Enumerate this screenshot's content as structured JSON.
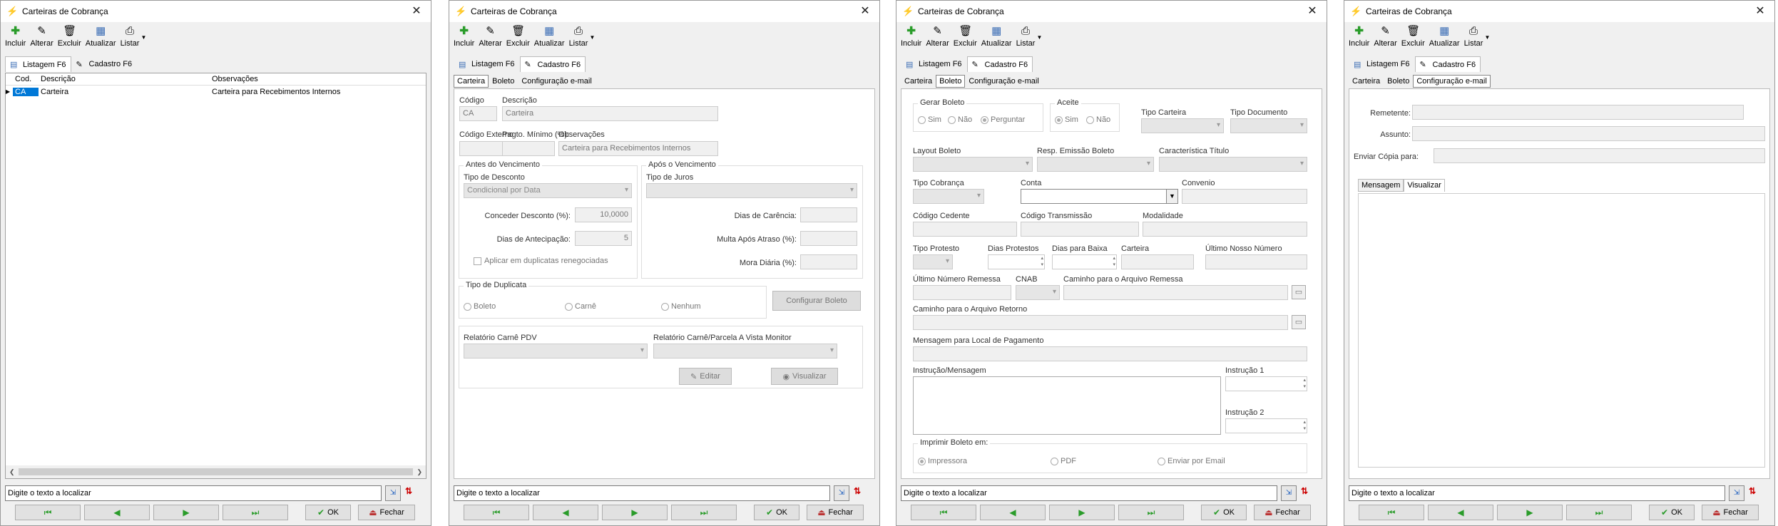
{
  "window_title": "Carteiras de Cobrança",
  "toolbar": {
    "incluir": "Incluir",
    "alterar": "Alterar",
    "excluir": "Excluir",
    "atualizar": "Atualizar",
    "listar": "Listar"
  },
  "tabs": {
    "listagem": "Listagem F6",
    "cadastro": "Cadastro F6"
  },
  "grid": {
    "columns": [
      "Cod.",
      "Descrição",
      "Observações"
    ],
    "rows": [
      {
        "cod": "CA",
        "descricao": "Carteira",
        "observacoes": "Carteira para Recebimentos Internos"
      }
    ]
  },
  "subtabs": {
    "carteira": "Carteira",
    "boleto": "Boleto",
    "email": "Configuração e-mail"
  },
  "carteira": {
    "codigo_label": "Código",
    "codigo": "CA",
    "descricao_label": "Descrição",
    "descricao": "Carteira",
    "codigo_externo_label": "Código Externo",
    "pagto_minimo_label": "Pagto. Mínimo (%):",
    "observacoes_label": "Observações",
    "observacoes": "Carteira para Recebimentos Internos",
    "antes_venc_title": "Antes do Vencimento",
    "tipo_desconto_label": "Tipo de Desconto",
    "tipo_desconto": "Condicional por Data",
    "conceder_desconto_label": "Conceder Desconto (%):",
    "conceder_desconto": "10,0000",
    "dias_antecipacao_label": "Dias de Antecipação:",
    "dias_antecipacao": "5",
    "aplicar_label": "Aplicar em duplicatas renegociadas",
    "apos_venc_title": "Após o Vencimento",
    "tipo_juros_label": "Tipo de Juros",
    "dias_carencia_label": "Dias de Carência:",
    "multa_label": "Multa Após Atraso (%):",
    "mora_label": "Mora Diária (%):",
    "tipo_duplicata_title": "Tipo de Duplicata",
    "dup_boleto": "Boleto",
    "dup_carne": "Carnê",
    "dup_nenhum": "Nenhum",
    "configurar_boleto": "Configurar Boleto",
    "relatorio_carne_label": "Relatório Carnê PDV",
    "relatorio_monitor_label": "Relatório Carnê/Parcela A Vista Monitor",
    "editar": "Editar",
    "visualizar": "Visualizar"
  },
  "boleto": {
    "gerar_title": "Gerar Boleto",
    "sim": "Sim",
    "nao": "Não",
    "perguntar": "Perguntar",
    "aceite_title": "Aceite",
    "tipo_carteira_label": "Tipo Carteira",
    "tipo_documento_label": "Tipo Documento",
    "layout_label": "Layout Boleto",
    "resp_emissao_label": "Resp. Emissão Boleto",
    "caracteristica_label": "Característica Título",
    "tipo_cobranca_label": "Tipo Cobrança",
    "conta_label": "Conta",
    "convenio_label": "Convenio",
    "codigo_cedente_label": "Código Cedente",
    "codigo_transmissao_label": "Código Transmissão",
    "modalidade_label": "Modalidade",
    "tipo_protesto_label": "Tipo Protesto",
    "dias_protestos_label": "Dias Protestos",
    "dias_baixa_label": "Dias para Baixa",
    "carteira_label": "Carteira",
    "ultimo_nosso_label": "Último Nosso Número",
    "ultimo_remessa_label": "Último Número Remessa",
    "cnab_label": "CNAB",
    "caminho_remessa_label": "Caminho para o Arquivo Remessa",
    "caminho_retorno_label": "Caminho para o Arquivo Retorno",
    "mensagem_label": "Mensagem  para Local  de Pagamento",
    "instrucao_msg_label": "Instrução/Mensagem",
    "instrucao1_label": "Instrução 1",
    "instrucao2_label": "Instrução 2",
    "imprimir_title": "Imprimir Boleto em:",
    "impressora": "Impressora",
    "pdf": "PDF",
    "email": "Enviar por Email"
  },
  "email": {
    "remetente_label": "Remetente:",
    "assunto_label": "Assunto:",
    "copia_label": "Enviar Cópia para:",
    "tab_mensagem": "Mensagem",
    "tab_visualizar": "Visualizar"
  },
  "find_placeholder": "Digite o texto a localizar",
  "ok_label": "OK",
  "fechar_label": "Fechar"
}
